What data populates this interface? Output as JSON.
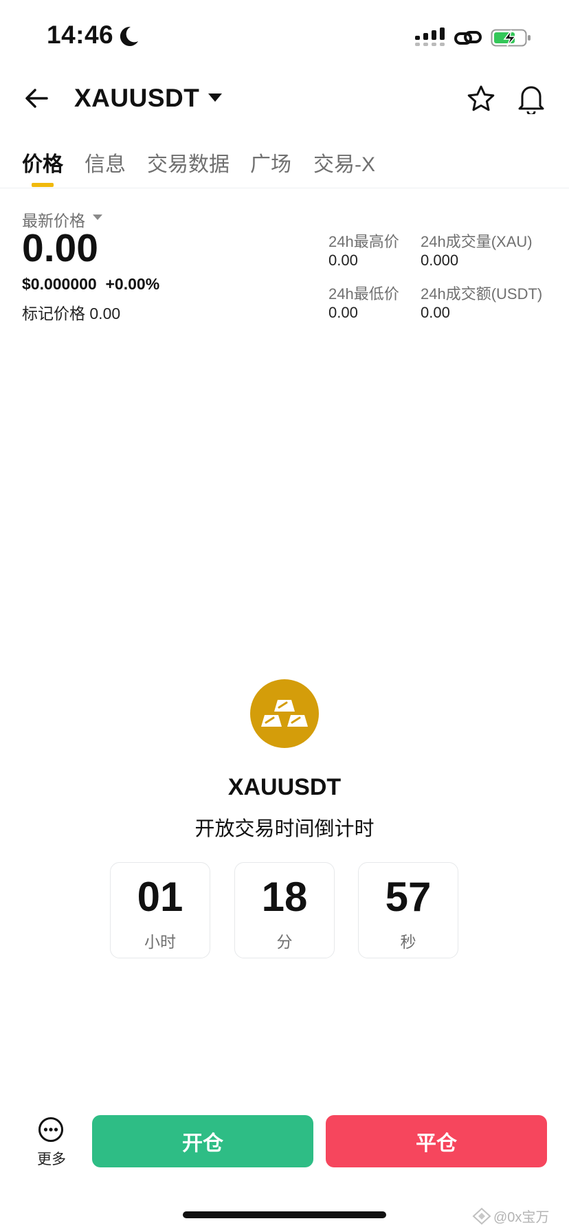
{
  "status_bar": {
    "time": "14:46"
  },
  "header": {
    "symbol": "XAUUSDT"
  },
  "tabs": [
    {
      "label": "价格",
      "active": true
    },
    {
      "label": "信息"
    },
    {
      "label": "交易数据"
    },
    {
      "label": "广场"
    },
    {
      "label": "交易-X"
    }
  ],
  "price": {
    "label": "最新价格",
    "value": "0.00",
    "usd_and_change": "$0.000000  +0.00%",
    "mark_label": "标记价格",
    "mark_value": "0.00"
  },
  "stats": {
    "high_label": "24h最高价",
    "high_value": "0.00",
    "volume_label": "24h成交量(XAU)",
    "volume_value": "0.000",
    "low_label": "24h最低价",
    "low_value": "0.00",
    "turnover_label": "24h成交额(USDT)",
    "turnover_value": "0.00"
  },
  "countdown": {
    "title": "XAUUSDT",
    "subtitle": "开放交易时间倒计时",
    "hours": "01",
    "hours_label": "小时",
    "minutes": "18",
    "minutes_label": "分",
    "seconds": "57",
    "seconds_label": "秒"
  },
  "bottom": {
    "more_label": "更多",
    "open_label": "开仓",
    "close_label": "平仓"
  },
  "watermark": "@0x宝万",
  "icons": [
    "moon-icon",
    "signal-icon",
    "link-icon",
    "battery-charging-icon",
    "back-arrow-icon",
    "star-icon",
    "bell-icon",
    "gold-bars-icon",
    "more-icon"
  ],
  "colors": {
    "accent": "#F0B90B",
    "buy": "#2EBD85",
    "sell": "#F6465D",
    "coin": "#D49D0A"
  }
}
